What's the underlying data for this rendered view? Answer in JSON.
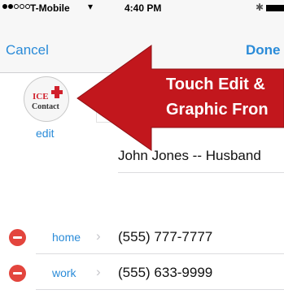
{
  "status_bar": {
    "carrier": "T-Mobile",
    "time": "4:40 PM",
    "signal_bars_filled": 2,
    "signal_bars_total": 5
  },
  "nav": {
    "cancel_label": "Cancel",
    "done_label": "Done"
  },
  "contact_photo": {
    "logo_line1": "ICE",
    "logo_line2": "Contact",
    "edit_label": "edit"
  },
  "contact": {
    "name": "John Jones -- Husband"
  },
  "phones": [
    {
      "label": "home",
      "value": "(555) 777-7777"
    },
    {
      "label": "work",
      "value": "(555) 633-9999"
    }
  ],
  "callout": {
    "line1": "Touch Edit &",
    "line2": "Graphic Fron",
    "color": "#c2171d"
  },
  "colors": {
    "accent": "#2a8bd8",
    "delete": "#e3453d"
  }
}
